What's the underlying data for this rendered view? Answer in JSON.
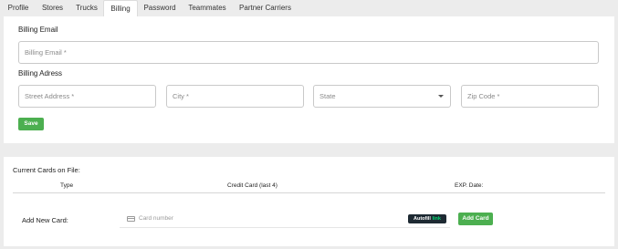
{
  "tabs": [
    {
      "label": "Profile"
    },
    {
      "label": "Stores"
    },
    {
      "label": "Trucks"
    },
    {
      "label": "Billing"
    },
    {
      "label": "Password"
    },
    {
      "label": "Teammates"
    },
    {
      "label": "Partner Carriers"
    }
  ],
  "active_tab": "Billing",
  "billing": {
    "email_section_title": "Billing Email",
    "email_placeholder": "Billing Email *",
    "address_section_title": "Billing Adress",
    "street_placeholder": "Street Address *",
    "city_placeholder": "City *",
    "state_placeholder": "State",
    "zip_placeholder": "Zip Code *",
    "save_label": "Save"
  },
  "cards": {
    "section_title": "Current Cards on File:",
    "columns": [
      "Type",
      "Credit Card (last 4)",
      "EXP. Date:"
    ],
    "add_new_label": "Add New Card:",
    "card_number_placeholder": "Card number",
    "autofill_text": "Autofill",
    "autofill_link_text": "link",
    "add_card_label": "Add Card"
  },
  "colors": {
    "accent_green": "#4caf50",
    "link_green": "#00d66f",
    "autofill_bg": "#1e2a33"
  },
  "icons": {
    "state_dropdown": "chevron-down-icon",
    "card_field": "credit-card-icon"
  }
}
